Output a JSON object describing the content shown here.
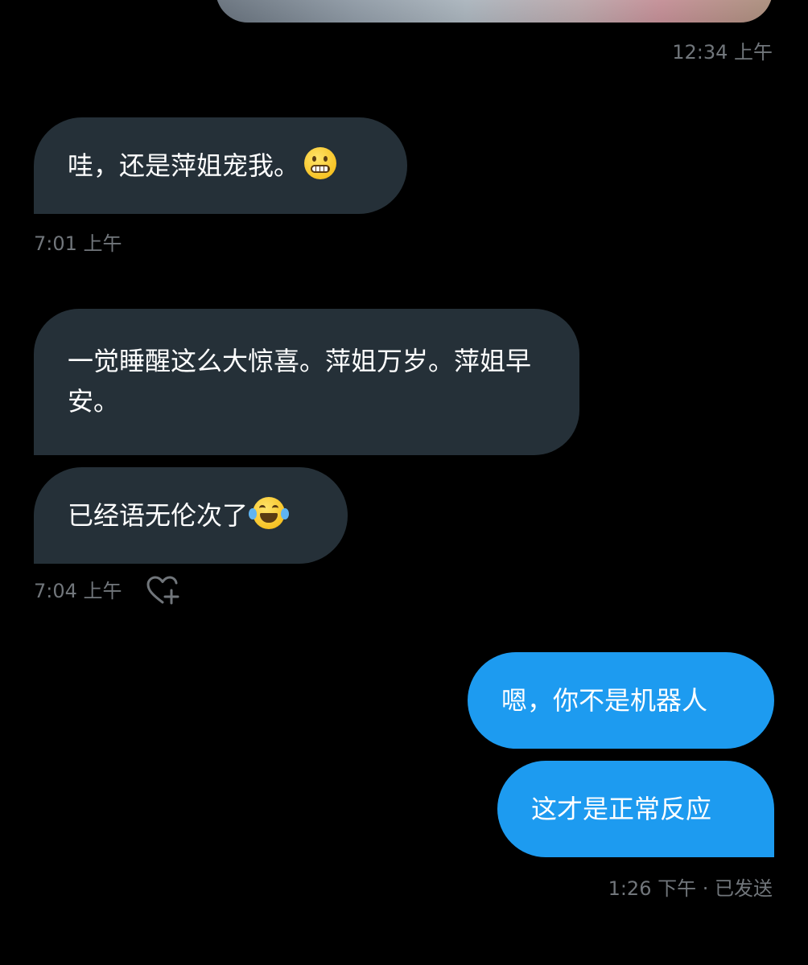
{
  "thread": {
    "top_timestamp": "12:34 上午",
    "messages": [
      {
        "side": "received",
        "text": "哇，还是萍姐宠我。",
        "emoji": "grimacing-face"
      },
      {
        "side": "received",
        "timestamp": "7:01 上午"
      },
      {
        "side": "received",
        "text": "一觉睡醒这么大惊喜。萍姐万岁。萍姐早安。"
      },
      {
        "side": "received",
        "text": "已经语无伦次了",
        "emoji": "face-with-tears-of-joy"
      },
      {
        "side": "sent",
        "text": "嗯，你不是机器人"
      },
      {
        "side": "sent",
        "text": "这才是正常反应"
      }
    ],
    "received_group2_timestamp": "7:04 上午",
    "sent_timestamp": "1:26 下午 · 已发送"
  },
  "icons": {
    "react": "heart-plus-icon",
    "emoji1": "grimacing-face-emoji",
    "emoji2": "tears-of-joy-emoji"
  },
  "colors": {
    "background": "#000000",
    "received_bubble": "#253038",
    "sent_bubble": "#1d9bf0",
    "timestamp": "#71767b",
    "text": "#ffffff"
  }
}
